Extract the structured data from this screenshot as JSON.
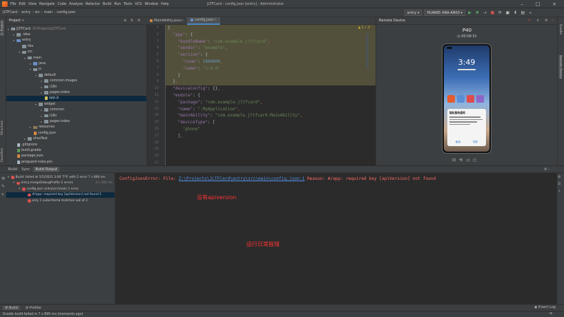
{
  "menubar": {
    "items": [
      "File",
      "Edit",
      "View",
      "Navigate",
      "Code",
      "Analyze",
      "Refactor",
      "Build",
      "Run",
      "Tools",
      "VCS",
      "Window",
      "Help"
    ],
    "title": "JLTFCard - config.json [entry] - Administrator"
  },
  "navbar": {
    "crumbs": [
      "JLTFCard",
      "entry",
      "src",
      "main",
      "config.json"
    ],
    "run_config": "entry",
    "device": "HUAWEI ANA-AN00"
  },
  "project": {
    "header": "Project",
    "tree": [
      {
        "label": "JLTFCard",
        "extra": "D:\\Projects\\JLTFCard",
        "depth": 0,
        "kind": "folder",
        "arrow": "▾"
      },
      {
        "label": ".idea",
        "depth": 1,
        "kind": "folder",
        "arrow": "▸"
      },
      {
        "label": "entry",
        "depth": 1,
        "kind": "folder-blue",
        "arrow": "▾"
      },
      {
        "label": "libs",
        "depth": 2,
        "kind": "folder",
        "arrow": ""
      },
      {
        "label": "src",
        "depth": 2,
        "kind": "folder",
        "arrow": "▾"
      },
      {
        "label": "main",
        "depth": 3,
        "kind": "folder",
        "arrow": "▾"
      },
      {
        "label": "java",
        "depth": 4,
        "kind": "folder-blue",
        "arrow": "▸"
      },
      {
        "label": "js",
        "depth": 4,
        "kind": "folder",
        "arrow": "▾"
      },
      {
        "label": "default",
        "depth": 5,
        "kind": "folder",
        "arrow": "▾"
      },
      {
        "label": "common.images",
        "depth": 6,
        "kind": "folder",
        "arrow": "▸"
      },
      {
        "label": "i18n",
        "depth": 6,
        "kind": "folder",
        "arrow": "▸"
      },
      {
        "label": "pages.index",
        "depth": 6,
        "kind": "folder",
        "arrow": "▸"
      },
      {
        "label": "app.js",
        "depth": 6,
        "kind": "file-js",
        "arrow": "",
        "selected": true
      },
      {
        "label": "widget",
        "depth": 5,
        "kind": "folder",
        "arrow": "▾"
      },
      {
        "label": "common",
        "depth": 6,
        "kind": "folder",
        "arrow": "▸"
      },
      {
        "label": "i18n",
        "depth": 6,
        "kind": "folder",
        "arrow": "▸"
      },
      {
        "label": "pages.index",
        "depth": 6,
        "kind": "folder",
        "arrow": "▸"
      },
      {
        "label": "resources",
        "depth": 4,
        "kind": "folder-res",
        "arrow": "▸"
      },
      {
        "label": "config.json",
        "depth": 4,
        "kind": "file-json",
        "arrow": ""
      },
      {
        "label": "ohosTest",
        "depth": 3,
        "kind": "folder",
        "arrow": "▸"
      },
      {
        "label": ".gitignore",
        "depth": 1,
        "kind": "file",
        "arrow": ""
      },
      {
        "label": "build.gradle",
        "depth": 1,
        "kind": "file-gradle",
        "arrow": ""
      },
      {
        "label": "package.json",
        "depth": 1,
        "kind": "file-json",
        "arrow": ""
      },
      {
        "label": "proguard-rules.pro",
        "depth": 1,
        "kind": "file",
        "arrow": ""
      }
    ]
  },
  "editor": {
    "tabs": [
      {
        "label": "MainAbility.java",
        "active": false,
        "color": "#d38a43"
      },
      {
        "label": "config.json",
        "active": true,
        "color": "#6a8ec7"
      }
    ],
    "line_numbers": [
      "1",
      "2",
      "3",
      "4",
      "5",
      "6",
      "7",
      "8",
      "9",
      "10",
      "11",
      "12",
      "13",
      "14",
      "15",
      "16",
      "17",
      "18",
      "19",
      "20",
      "21"
    ],
    "inspection": "▲ 1  ✓ 4"
  },
  "remote": {
    "header": "Remote Device",
    "device_name": "P40",
    "timer": "00:58:31",
    "clock": "3:49",
    "dialog_title": "隐私服务通知",
    "dialog_cancel": "取消",
    "dialog_ok": "同意"
  },
  "build": {
    "tabs": [
      "Build:",
      "Sync",
      "Build Output"
    ],
    "tree": [
      {
        "label": "Build: failed at 5/5/2021 3:00 下午 with 2 error 7 s 890 ms",
        "depth": 0,
        "arrow": "▾",
        "time": ""
      },
      {
        "label": "entry:mergeDebugProfile  2 errors",
        "depth": 1,
        "arrow": "▾",
        "time": "3 s 344 ms"
      },
      {
        "label": "config.json  entry\\src\\main 1 error",
        "depth": 2,
        "arrow": "▾",
        "time": ""
      },
      {
        "label": "#/app: required key [apiVersion] not found  1",
        "depth": 3,
        "arrow": "",
        "time": "",
        "selected": true
      },
      {
        "label": "only 1 subschema matches out of 2",
        "depth": 3,
        "arrow": "",
        "time": ""
      }
    ],
    "error_prefix": "ConfigJsonError:  File: ",
    "error_path": "Z:\\Projects\\JLTFCard\\entry\\src\\main\\config.json:1",
    "error_reason": "  Reason: #/app: required key [apiVersion] not found",
    "annotation_1": "没有apiversion",
    "annotation_2": "运行日常报错"
  },
  "bottom_tabs": {
    "build": "Build",
    "profiler": "Profiler",
    "event_log": "Event Log"
  },
  "status": "Gradle build failed in 7 s 890 ms (moments ago)"
}
